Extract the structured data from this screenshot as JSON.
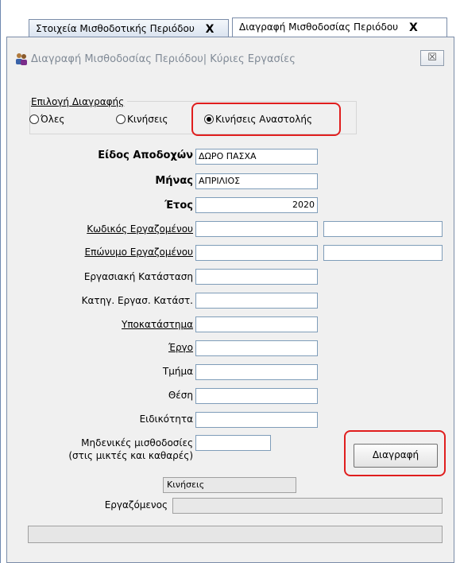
{
  "tabs": [
    {
      "label": "Στοιχεία Μισθοδοτικής Περιόδου",
      "close": "X"
    },
    {
      "label": "Διαγραφή Μισθοδοσίας Περιόδου",
      "close": "X"
    }
  ],
  "window": {
    "title": "Διαγραφή Μισθοδοσίας Περιόδου| Κύριες Εργασίες",
    "close_label": "☒"
  },
  "deletion_choice": {
    "label": "Επιλογή Διαγραφής",
    "options": [
      {
        "label": "Όλες",
        "selected": false
      },
      {
        "label": "Κινήσεις",
        "selected": false
      },
      {
        "label": "Κινήσεις Αναστολής",
        "selected": true
      }
    ]
  },
  "fields": {
    "earnings_type": {
      "label": "Είδος Αποδοχών",
      "value": "ΔΩΡΟ ΠΑΣΧΑ"
    },
    "month": {
      "label": "Μήνας",
      "value": "ΑΠΡΙΛΙΟΣ"
    },
    "year": {
      "label": "Έτος",
      "value": "2020"
    },
    "employee_code": {
      "label": "Κωδικός Εργαζομένου",
      "value": ""
    },
    "employee_surname": {
      "label": "Επώνυμο Εργαζομένου",
      "value": ""
    },
    "work_status": {
      "label": "Εργασιακή Κατάσταση",
      "value": ""
    },
    "work_status_category": {
      "label": "Κατηγ. Εργασ. Κατάστ.",
      "value": ""
    },
    "branch": {
      "label": "Υποκατάστημα",
      "value": ""
    },
    "project": {
      "label": "Έργο",
      "value": ""
    },
    "department": {
      "label": "Τμήμα",
      "value": ""
    },
    "position": {
      "label": "Θέση",
      "value": ""
    },
    "specialty": {
      "label": "Ειδικότητα",
      "value": ""
    },
    "zero_payrolls": {
      "label_line1": "Μηδενικές μισθοδοσίες",
      "label_line2": "(στις μικτές και καθαρές)",
      "value": ""
    }
  },
  "delete_button": "Διαγραφή",
  "progress": {
    "stage_text": "Κινήσεις",
    "employee_label": "Εργαζόμενος",
    "employee_value": ""
  },
  "colors": {
    "highlight": "#e01e1e",
    "accent": "#7a8ca8"
  }
}
